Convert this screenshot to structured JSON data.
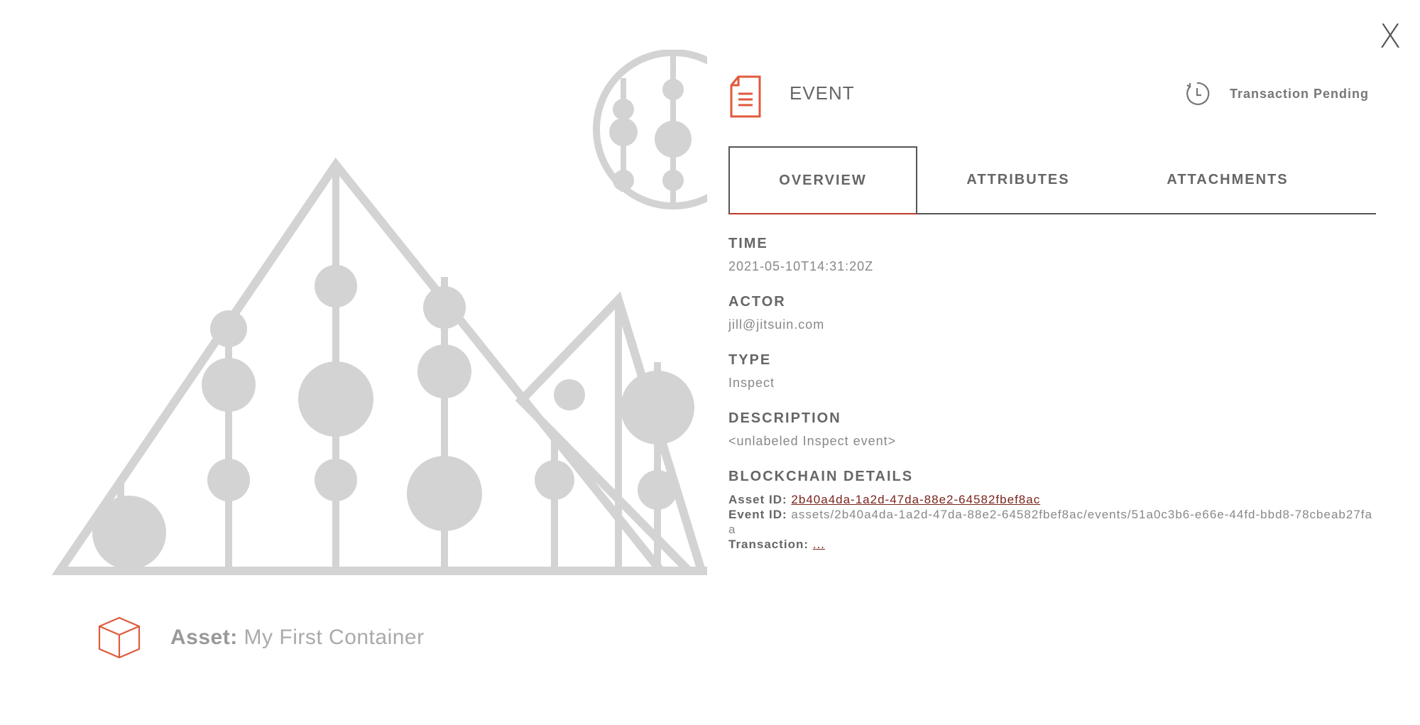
{
  "close": {
    "label": "X"
  },
  "asset": {
    "prefix": "Asset:",
    "name": "My First Container"
  },
  "event": {
    "title": "EVENT",
    "status": "Transaction Pending",
    "tabs": [
      "OVERVIEW",
      "ATTRIBUTES",
      "ATTACHMENTS"
    ],
    "time_label": "TIME",
    "time_value": "2021-05-10T14:31:20Z",
    "actor_label": "ACTOR",
    "actor_value": "jill@jitsuin.com",
    "type_label": "TYPE",
    "type_value": "Inspect",
    "description_label": "DESCRIPTION",
    "description_value": "<unlabeled Inspect event>",
    "blockchain_label": "BLOCKCHAIN DETAILS",
    "asset_id_label": "Asset ID:",
    "asset_id_value": "2b40a4da-1a2d-47da-88e2-64582fbef8ac",
    "event_id_label": "Event ID:",
    "event_id_value": "assets/2b40a4da-1a2d-47da-88e2-64582fbef8ac/events/51a0c3b6-e66e-44fd-bbd8-78cbeab27faa",
    "transaction_label": "Transaction:",
    "transaction_value": "..."
  },
  "colors": {
    "accent": "#e05a3c",
    "link": "#7b241c",
    "illustration": "#d3d3d3"
  },
  "icons": {
    "document": "document-icon",
    "clock": "clock-icon",
    "cube": "cube-icon",
    "close": "close-icon"
  }
}
